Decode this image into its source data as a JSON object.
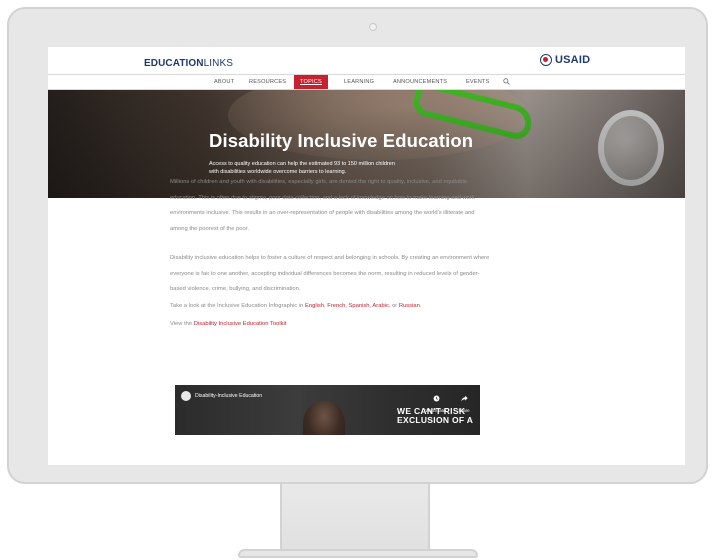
{
  "header": {
    "brand_bold": "EDUCATION",
    "brand_light": "LINKS",
    "partner_logo": "USAID"
  },
  "nav": {
    "items": [
      "ABOUT",
      "RESOURCES",
      "TOPICS",
      "LEARNING",
      "ANNOUNCEMENTS",
      "EVENTS"
    ],
    "active": "TOPICS",
    "search_icon": "search-icon"
  },
  "hero": {
    "title": "Disability Inclusive Education",
    "subtitle_line1": "Access to quality education can help the estimated 93 to 150 million children",
    "subtitle_line2": "with disabilities worldwide overcome barriers to learning."
  },
  "content": {
    "para1": "Millions of children and youth with disabilities, especially girls, are denied the right to quality, inclusive, and equitable education. This is often due to stigma, poor data collection, and a lack of knowledge on how to make learning and work environments inclusive. This results in an over-representation of people with disabilities among the world's illiterate and among the poorest of the poor.",
    "para2": "Disability inclusive education helps to foster a culture of respect and belonging in schools. By creating an environment where everyone is fair to one another, accepting individual differences becomes the norm, resulting in reduced levels of gender-based violence, crime, bullying, and discrimination.",
    "infographic_prefix": "Take a look at the Inclusive Education Infographic in ",
    "languages": [
      "English",
      "French",
      "Spanish",
      "Arabic",
      "Russian"
    ],
    "infographic_suffix": ".",
    "toolkit_prefix": "View the ",
    "toolkit_link": "Disability Inclusive Education Toolkit"
  },
  "video": {
    "title": "Disability-Inclusive Education",
    "watch_later": "Watch later",
    "share": "Share",
    "overlay_line1": "WE CAN'T RISK",
    "overlay_line2": "EXCLUSION OF A"
  },
  "colors": {
    "brand_navy": "#1f3a6b",
    "accent_red": "#c8202f",
    "body_text": "#8a8a8a"
  }
}
